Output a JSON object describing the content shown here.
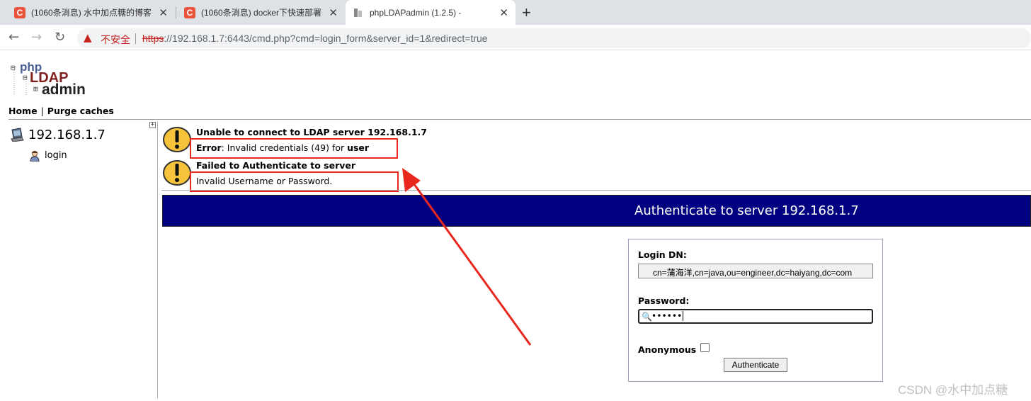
{
  "browser": {
    "tabs": [
      {
        "favicon": "C",
        "title": "(1060条消息) 水中加点糖的博客",
        "active": false
      },
      {
        "favicon": "C",
        "title": "(1060条消息) docker下快速部署",
        "active": false
      },
      {
        "favicon": "pla",
        "title": "phpLDAPadmin (1.2.5) -",
        "active": true
      }
    ],
    "close_glyph": "✕",
    "new_tab_glyph": "+",
    "nav": {
      "back": "←",
      "forward": "→",
      "reload": "↻"
    },
    "security_label": "不安全",
    "url_protocol": "https",
    "url_rest": "://192.168.1.7:6443/cmd.php?cmd=login_form&server_id=1&redirect=true"
  },
  "logo": {
    "line1": "php",
    "line2": "LDAP",
    "line3": "admin"
  },
  "menu": {
    "home": "Home",
    "separator": "|",
    "purge": "Purge caches"
  },
  "sidebar": {
    "server": "192.168.1.7",
    "login": "login",
    "expand": "+"
  },
  "messages": [
    {
      "title": "Unable to connect to LDAP server 192.168.1.7",
      "body_prefix": "Error",
      "body_middle": ": Invalid credentials (49) for ",
      "body_suffix": "user"
    },
    {
      "title": "Failed to Authenticate to server",
      "body": "Invalid Username or Password."
    }
  ],
  "auth": {
    "header": "Authenticate to server 192.168.1.7",
    "login_dn_label": "Login DN:",
    "login_dn_value": "cn=蒲海洋,cn=java,ou=engineer,dc=haiyang,dc=com",
    "password_label": "Password:",
    "password_value": "••••••",
    "anonymous_label": "Anonymous",
    "anonymous_checked": false,
    "button": "Authenticate"
  },
  "watermark": "CSDN @水中加点糖",
  "colors": {
    "header_bg": "#000080",
    "annotation_red": "#e8281f",
    "alert_yellow": "#f7c33a"
  }
}
